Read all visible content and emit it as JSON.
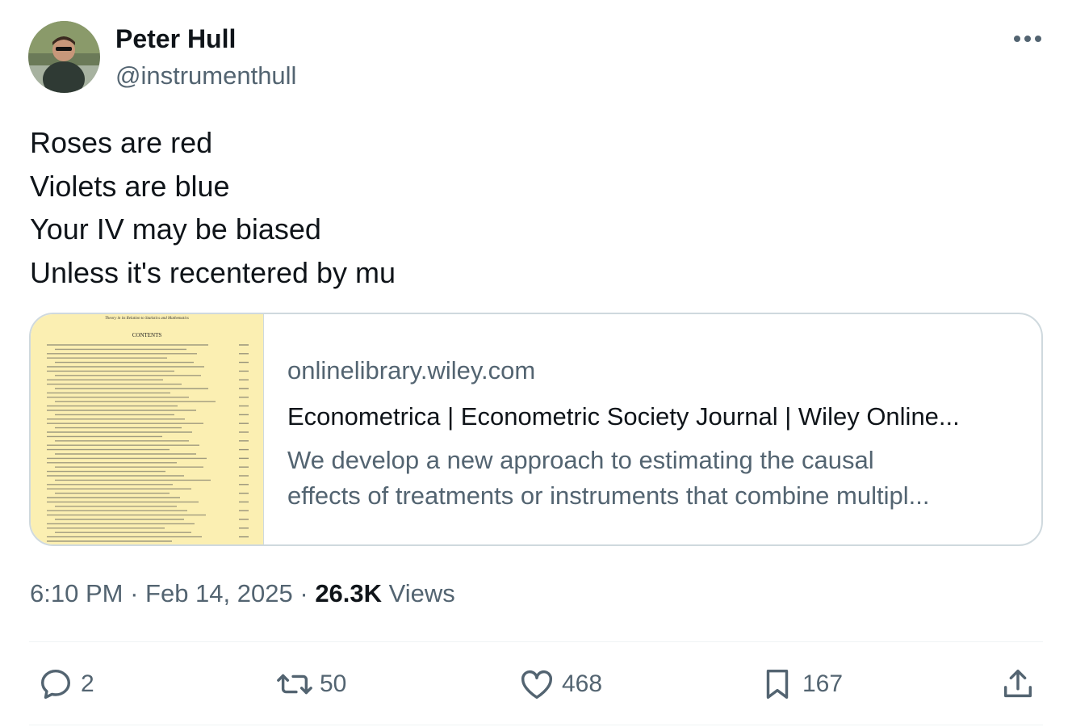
{
  "author": {
    "name": "Peter Hull",
    "handle": "@instrumenthull"
  },
  "tweet": {
    "lines": [
      "Roses are red",
      "Violets are blue",
      "Your IV may be biased",
      "Unless it's recentered by mu"
    ]
  },
  "card": {
    "domain": "onlinelibrary.wiley.com",
    "title": "Econometrica | Econometric Society Journal | Wiley Online...",
    "description_lines": [
      "We develop a new approach to estimating the causal",
      "effects of treatments or instruments that combine multipl..."
    ],
    "thumbnail": {
      "header": "Theory in its Relation to Statistics and Mathematics",
      "heading": "CONTENTS",
      "background": "#fbefb2"
    }
  },
  "meta": {
    "time": "6:10 PM",
    "date": "Feb 14, 2025",
    "views_count": "26.3K",
    "views_label": "Views",
    "separator": "·"
  },
  "actions": {
    "replies": "2",
    "reposts": "50",
    "likes": "468",
    "bookmarks": "167"
  },
  "colors": {
    "text": "#0f1419",
    "secondary": "#536471",
    "border": "#cfd9de"
  }
}
